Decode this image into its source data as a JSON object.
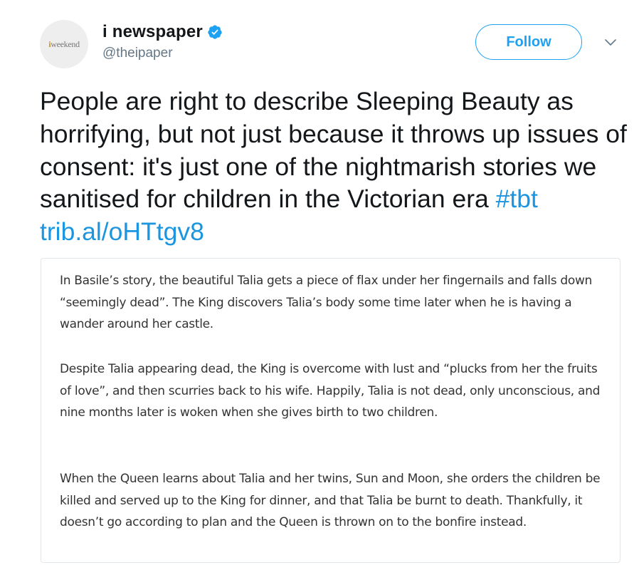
{
  "account": {
    "avatar_brand_i": "i",
    "avatar_brand_rest": "weekend",
    "display_name": "i newspaper",
    "handle": "@theipaper",
    "verified": true
  },
  "actions": {
    "follow_label": "Follow"
  },
  "tweet": {
    "text": "People are right to describe Sleeping Beauty as horrifying, but not just because it throws up issues of consent: it's just one of the nightmarish stories we sanitised for children in the Victorian era ",
    "hashtag": "#tbt",
    "link": "trib.al/oHTtgv8"
  },
  "quote_image": {
    "paragraphs": [
      "In Basile’s story, the beautiful Talia gets a piece of flax under her fingernails and falls down “seemingly dead”. The King discovers Talia’s body some time later when he is having a wander around her castle.",
      "Despite Talia appearing dead, the King is overcome with lust and “plucks from her the fruits of love”, and then scurries back to his wife. Happily, Talia is not dead, only unconscious, and nine months later is woken when she gives birth to two children.",
      "When the Queen learns about Talia and her twins, Sun and Moon, she orders the children be killed and served up to the King for dinner, and that Talia be burnt to death. Thankfully, it doesn’t go according to plan and the Queen is thrown on to the bonfire instead."
    ]
  },
  "colors": {
    "accent": "#1da1f2",
    "link": "#1b95e0",
    "secondary_text": "#657786",
    "border": "#e1e8ed"
  },
  "icons": {
    "verified": "verified-badge-icon",
    "caret": "chevron-down-icon"
  }
}
